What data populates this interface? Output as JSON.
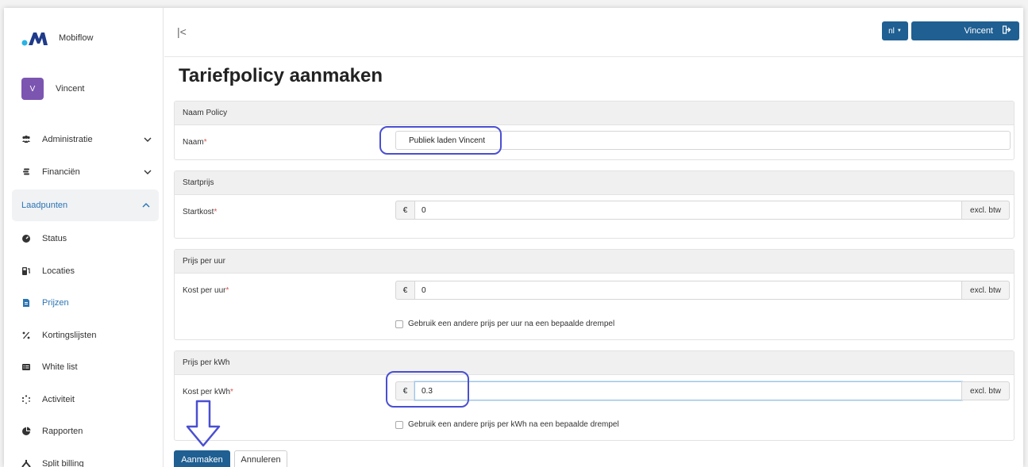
{
  "brand": {
    "name": "Mobiflow"
  },
  "user": {
    "initial": "V",
    "name": "Vincent"
  },
  "sidebar": {
    "items": [
      {
        "label": "Administratie",
        "icon": "users-icon"
      },
      {
        "label": "Financiën",
        "icon": "coins-icon"
      },
      {
        "label": "Laadpunten",
        "icon": ""
      },
      {
        "label": "Status",
        "icon": "gauge-icon"
      },
      {
        "label": "Locaties",
        "icon": "charging-station-icon"
      },
      {
        "label": "Prijzen",
        "icon": "price-file-icon"
      },
      {
        "label": "Kortingslijsten",
        "icon": "percent-icon"
      },
      {
        "label": "White list",
        "icon": "list-icon"
      },
      {
        "label": "Activiteit",
        "icon": "spinner-icon"
      },
      {
        "label": "Rapporten",
        "icon": "pie-chart-icon"
      },
      {
        "label": "Split billing",
        "icon": "split-icon"
      }
    ]
  },
  "topbar": {
    "lang": "nl",
    "user_label": "Vincent"
  },
  "page": {
    "title": "Tariefpolicy aanmaken"
  },
  "sections": {
    "naam_policy": {
      "header": "Naam Policy",
      "label": "Naam",
      "value": "Publiek laden Vincent"
    },
    "startprijs": {
      "header": "Startprijs",
      "label": "Startkost",
      "currency": "€",
      "value": "0",
      "suffix": "excl. btw"
    },
    "prijs_per_uur": {
      "header": "Prijs per uur",
      "label": "Kost per uur",
      "currency": "€",
      "value": "0",
      "suffix": "excl. btw",
      "checkbox": "Gebruik een andere prijs per uur na een bepaalde drempel"
    },
    "prijs_per_kwh": {
      "header": "Prijs per kWh",
      "label": "Kost per kWh",
      "currency": "€",
      "value": "0.3",
      "suffix": "excl. btw",
      "checkbox": "Gebruik een andere prijs per kWh na een bepaalde drempel"
    }
  },
  "required_mark": "*",
  "actions": {
    "create": "Aanmaken",
    "cancel": "Annuleren"
  },
  "colors": {
    "primary": "#1f5f92",
    "avatar": "#7c55b1",
    "annotation": "#4a4fd1",
    "link": "#2c74b3"
  }
}
